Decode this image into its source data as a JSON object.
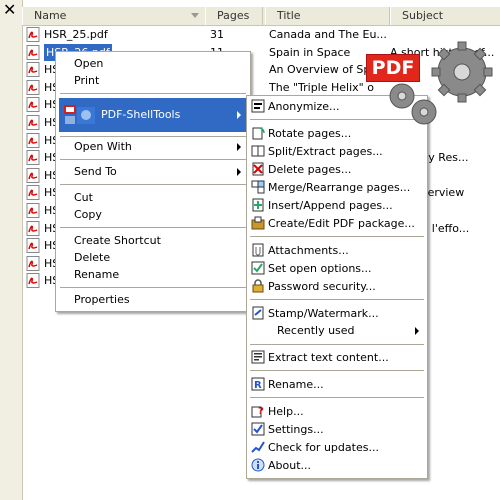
{
  "close_glyph": "✕",
  "columns": {
    "name": "Name",
    "pages": "Pages",
    "title": "Title",
    "subject": "Subject"
  },
  "files": [
    {
      "name": "HSR_25.pdf",
      "pages": "31",
      "title": "Canada and The Eu...",
      "subject": ""
    },
    {
      "name": "HSR_26.pdf",
      "pages": "11",
      "title": "Spain in Space",
      "subject": "A short history of..."
    },
    {
      "name": "HS",
      "pages": "",
      "title": "An Overview of Spa",
      "subject": ""
    },
    {
      "name": "HS",
      "pages": "",
      "title": "The \"Triple Helix\" o",
      "subject": ""
    },
    {
      "name": "HS",
      "pages": "",
      "title": "",
      "subject": ""
    },
    {
      "name": "HS",
      "pages": "",
      "title": "",
      "subject": "istory"
    },
    {
      "name": "HS",
      "pages": "",
      "title": "",
      "subject": ""
    },
    {
      "name": "HS",
      "pages": "",
      "title": "",
      "subject": "ation by Res..."
    },
    {
      "name": "HS",
      "pages": "",
      "title": "",
      "subject": ""
    },
    {
      "name": "HS",
      "pages": "",
      "title": "",
      "subject": "ical Overview"
    },
    {
      "name": "HS",
      "pages": "",
      "title": "",
      "subject": ""
    },
    {
      "name": "HS",
      "pages": "",
      "title": "",
      "subject": "ution a l'effo..."
    },
    {
      "name": "HS",
      "pages": "",
      "title": "",
      "subject": ""
    },
    {
      "name": "HS",
      "pages": "",
      "title": "",
      "subject": ""
    },
    {
      "name": "HS",
      "pages": "",
      "title": "",
      "subject": ""
    }
  ],
  "context_menu": {
    "open": "Open",
    "print": "Print",
    "pdf_shelltools": "PDF-ShellTools",
    "open_with": "Open With",
    "send_to": "Send To",
    "cut": "Cut",
    "copy": "Copy",
    "create_shortcut": "Create Shortcut",
    "delete": "Delete",
    "rename": "Rename",
    "properties": "Properties"
  },
  "submenu": {
    "anonymize": "Anonymize...",
    "rotate": "Rotate pages...",
    "split": "Split/Extract pages...",
    "delete_pages": "Delete pages...",
    "merge": "Merge/Rearrange pages...",
    "insert": "Insert/Append pages...",
    "package": "Create/Edit PDF package...",
    "attachments": "Attachments...",
    "open_options": "Set open options...",
    "password": "Password security...",
    "stamp": "Stamp/Watermark...",
    "recent": "Recently used",
    "extract_text": "Extract text content...",
    "rename": "Rename...",
    "help": "Help...",
    "settings": "Settings...",
    "updates": "Check for updates...",
    "about": "About..."
  },
  "badge": {
    "text": "PDF"
  },
  "colors": {
    "selection": "#316ac5",
    "pdf_red": "#e1261c",
    "menu_border": "#aca899"
  }
}
